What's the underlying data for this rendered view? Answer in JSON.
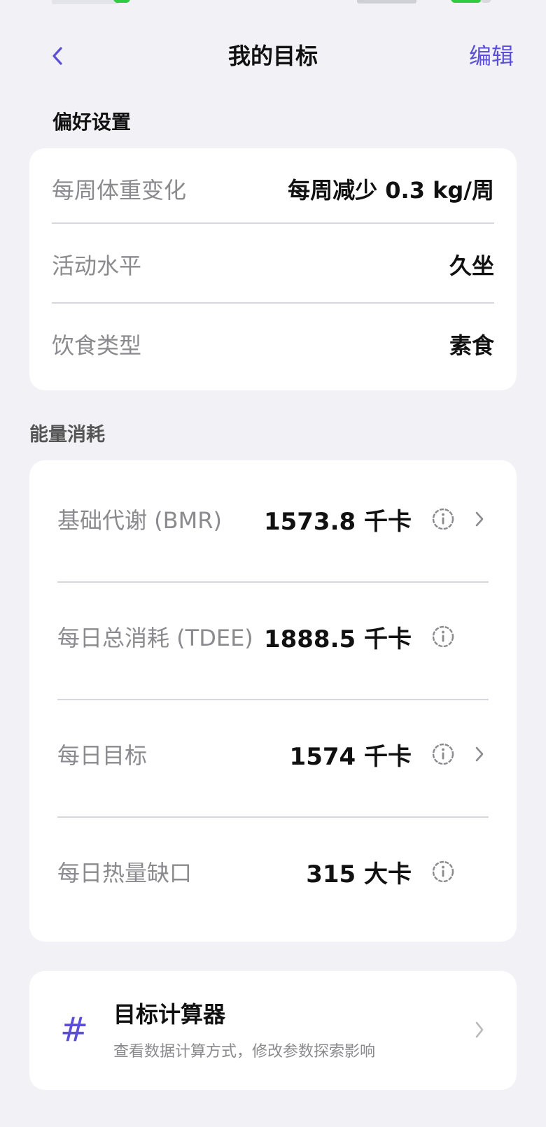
{
  "nav": {
    "title": "我的目标",
    "edit_label": "编辑"
  },
  "preferences": {
    "section_title": "偏好设置",
    "rows": [
      {
        "label": "每周体重变化",
        "value": "每周减少 0.3 kg/周"
      },
      {
        "label": "活动水平",
        "value": "久坐"
      },
      {
        "label": "饮食类型",
        "value": "素食"
      }
    ]
  },
  "energy": {
    "section_title": "能量消耗",
    "rows": [
      {
        "label": "基础代谢 (BMR)",
        "value": "1573.8 千卡",
        "has_chevron": true
      },
      {
        "label": "每日总消耗 (TDEE)",
        "value": "1888.5 千卡",
        "has_chevron": false
      },
      {
        "label": "每日目标",
        "value": "1574 千卡",
        "has_chevron": true
      },
      {
        "label": "每日热量缺口",
        "value": "315 大卡",
        "has_chevron": false
      }
    ]
  },
  "calculator": {
    "title": "目标计算器",
    "subtitle": "查看数据计算方式，修改参数探索影响",
    "icon_glyph": "#"
  },
  "colors": {
    "accent": "#5b4fd6",
    "background": "#f1f1f6",
    "card": "#ffffff",
    "label_gray": "#8a8a8f"
  },
  "icons": {
    "back": "chevron-left-icon",
    "info": "info-circle-icon",
    "chevron": "chevron-right-icon",
    "calculator": "hash-icon"
  }
}
